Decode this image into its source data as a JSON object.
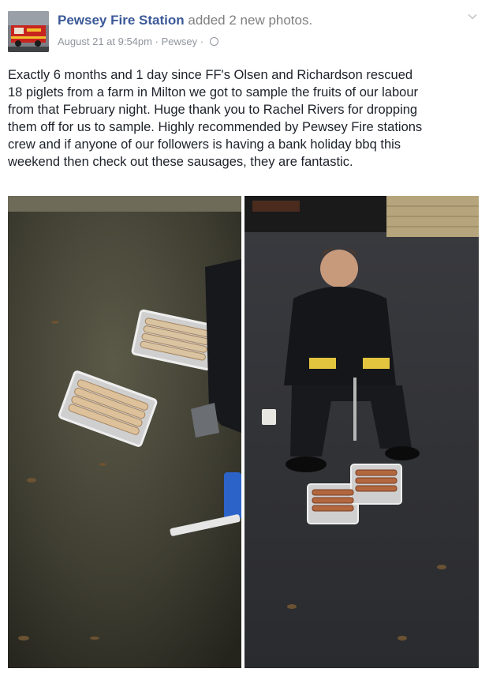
{
  "post": {
    "author": "Pewsey Fire Station",
    "action": "added 2 new photos.",
    "timestamp": "August 21 at 9:54pm",
    "location": "Pewsey",
    "separator": "·",
    "privacy_icon": "globe-icon",
    "menu_icon": "chevron-down-icon",
    "text_lines": [
      "Exactly 6 months and 1 day since FF's Olsen and Richardson rescued",
      "18 piglets from a farm in Milton we got to sample the fruits of our labour",
      "from that February night. Huge thank you to Rachel Rivers for dropping",
      "them off for us to sample. Highly recommended by Pewsey Fire stations",
      "crew and if anyone of our followers is having a bank holiday bbq this",
      "weekend then check out these sausages, they are fantastic."
    ]
  },
  "colors": {
    "author_link": "#3b5998",
    "meta_text": "#90949c",
    "body_text": "#1d2129"
  }
}
